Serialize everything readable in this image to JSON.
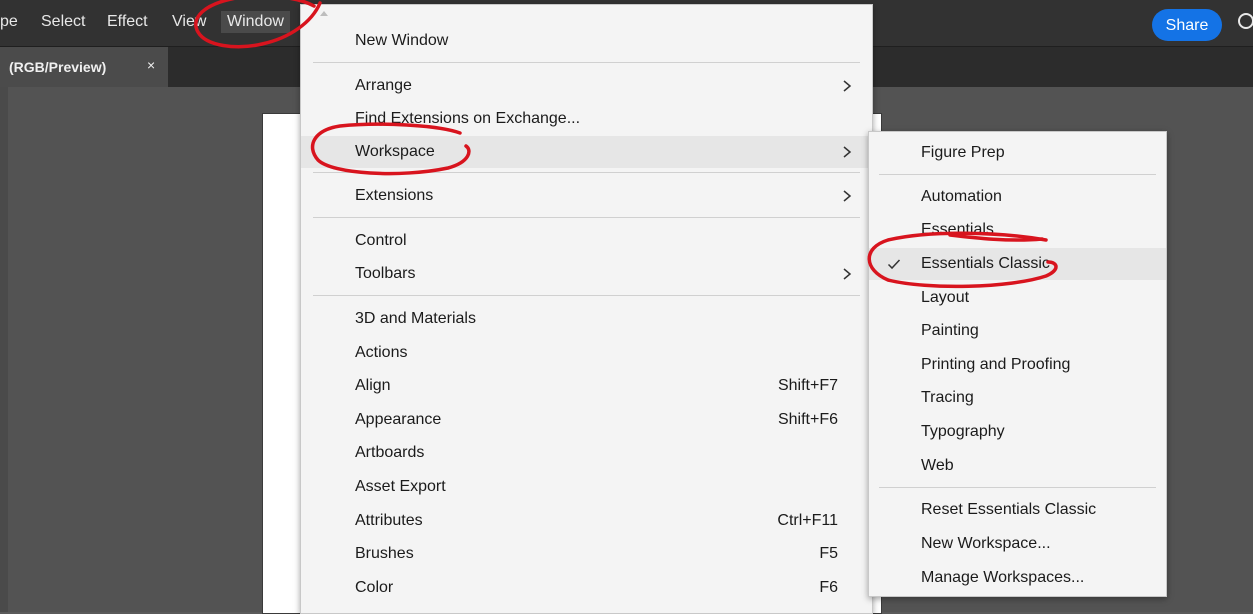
{
  "menubar": {
    "items": [
      "pe",
      "Select",
      "Effect",
      "View",
      "Window"
    ],
    "share_label": "Share"
  },
  "document_tab": {
    "label": "(RGB/Preview)",
    "close_glyph": "×"
  },
  "window_menu": {
    "items": [
      {
        "label": "New Window",
        "shortcut": "",
        "submenu": false
      },
      {
        "label": "Arrange",
        "shortcut": "",
        "submenu": true
      },
      {
        "label": "Find Extensions on Exchange...",
        "shortcut": "",
        "submenu": false
      },
      {
        "label": "Workspace",
        "shortcut": "",
        "submenu": true,
        "highlighted": true
      },
      {
        "label": "Extensions",
        "shortcut": "",
        "submenu": true
      },
      {
        "label": "Control",
        "shortcut": "",
        "submenu": false
      },
      {
        "label": "Toolbars",
        "shortcut": "",
        "submenu": true
      },
      {
        "label": "3D and Materials",
        "shortcut": "",
        "submenu": false
      },
      {
        "label": "Actions",
        "shortcut": "",
        "submenu": false
      },
      {
        "label": "Align",
        "shortcut": "Shift+F7",
        "submenu": false
      },
      {
        "label": "Appearance",
        "shortcut": "Shift+F6",
        "submenu": false
      },
      {
        "label": "Artboards",
        "shortcut": "",
        "submenu": false
      },
      {
        "label": "Asset Export",
        "shortcut": "",
        "submenu": false
      },
      {
        "label": "Attributes",
        "shortcut": "Ctrl+F11",
        "submenu": false
      },
      {
        "label": "Brushes",
        "shortcut": "F5",
        "submenu": false
      },
      {
        "label": "Color",
        "shortcut": "F6",
        "submenu": false
      }
    ]
  },
  "workspace_submenu": {
    "items": [
      {
        "label": "Figure Prep",
        "checked": false
      },
      {
        "label": "Automation",
        "checked": false
      },
      {
        "label": "Essentials",
        "checked": false
      },
      {
        "label": "Essentials Classic",
        "checked": true
      },
      {
        "label": "Layout",
        "checked": false
      },
      {
        "label": "Painting",
        "checked": false
      },
      {
        "label": "Printing and Proofing",
        "checked": false
      },
      {
        "label": "Tracing",
        "checked": false
      },
      {
        "label": "Typography",
        "checked": false
      },
      {
        "label": "Web",
        "checked": false
      },
      {
        "label": "Reset Essentials Classic",
        "checked": false
      },
      {
        "label": "New Workspace...",
        "checked": false
      },
      {
        "label": "Manage Workspaces...",
        "checked": false
      }
    ]
  },
  "colors": {
    "accent": "#1473e6",
    "annotation": "#d8141e",
    "menu_bg": "#f4f4f4",
    "highlight_bg": "#e6e6e6"
  }
}
